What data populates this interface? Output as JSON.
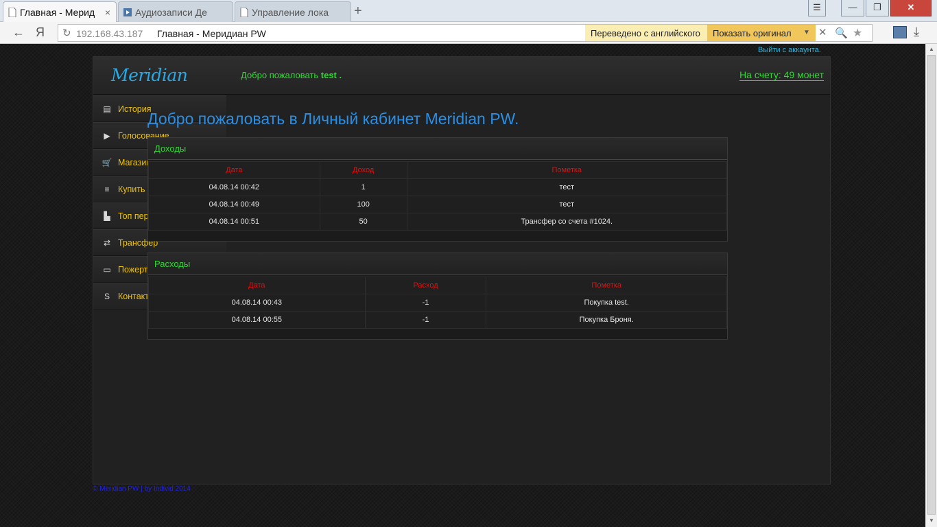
{
  "browser": {
    "tabs": [
      {
        "title": "Главная - Мерид",
        "active": true
      },
      {
        "title": "Аудиозаписи Де",
        "active": false
      },
      {
        "title": "Управление лока",
        "active": false
      }
    ],
    "new_tab": "+",
    "window_buttons": {
      "menu": "☰",
      "minimize": "—",
      "maximize": "❐",
      "close": "✕"
    },
    "address": {
      "host": "192.168.43.187",
      "title": "Главная - Меридиан PW"
    },
    "nav": {
      "back": "←",
      "yandex": "Я",
      "reload": "↻"
    },
    "translate": {
      "note": "Переведено с английского",
      "show_original": "Показать оригинал",
      "dropdown": "▼",
      "close": "✕"
    },
    "search": "🔍",
    "star": "★",
    "download": "⤓"
  },
  "page": {
    "logout": "Выйти с аккаунта.",
    "logo": "Meridian",
    "welcome_prefix": "Добро пожаловать ",
    "username": "test .",
    "balance": "На счету: 49 монет",
    "sidebar": [
      {
        "label": "История",
        "icon": "history-icon",
        "glyph": "▤"
      },
      {
        "label": "Голосование",
        "icon": "arrow-right-icon",
        "glyph": "▶"
      },
      {
        "label": "Магазин",
        "icon": "cart-icon",
        "glyph": "🛒"
      },
      {
        "label": "Купить голд",
        "icon": "coins-icon",
        "glyph": "≡"
      },
      {
        "label": "Топ персонажей",
        "icon": "podium-icon",
        "glyph": "▙"
      },
      {
        "label": "Трансфер",
        "icon": "shuffle-icon",
        "glyph": "⇄"
      },
      {
        "label": "Пожертвования",
        "icon": "money-icon",
        "glyph": "▭"
      },
      {
        "label": "Контакты",
        "icon": "skype-icon",
        "glyph": "S"
      }
    ],
    "main_title": "Добро пожаловать в Личный кабинет Meridian PW.",
    "income": {
      "title": "Доходы",
      "columns": [
        "Дата",
        "Доход",
        "Пометка"
      ],
      "rows": [
        [
          "04.08.14 00:42",
          "1",
          "тест"
        ],
        [
          "04.08.14 00:49",
          "100",
          "тест"
        ],
        [
          "04.08.14 00:51",
          "50",
          "Трансфер со счета #1024."
        ]
      ]
    },
    "expense": {
      "title": "Расходы",
      "columns": [
        "Дата",
        "Расход",
        "Пометка"
      ],
      "rows": [
        [
          "04.08.14 00:43",
          "-1",
          "Покупка test."
        ],
        [
          "04.08.14 00:55",
          "-1",
          "Покупка Броня."
        ]
      ]
    },
    "footer": "© Meridian PW | by Individ 2014"
  }
}
